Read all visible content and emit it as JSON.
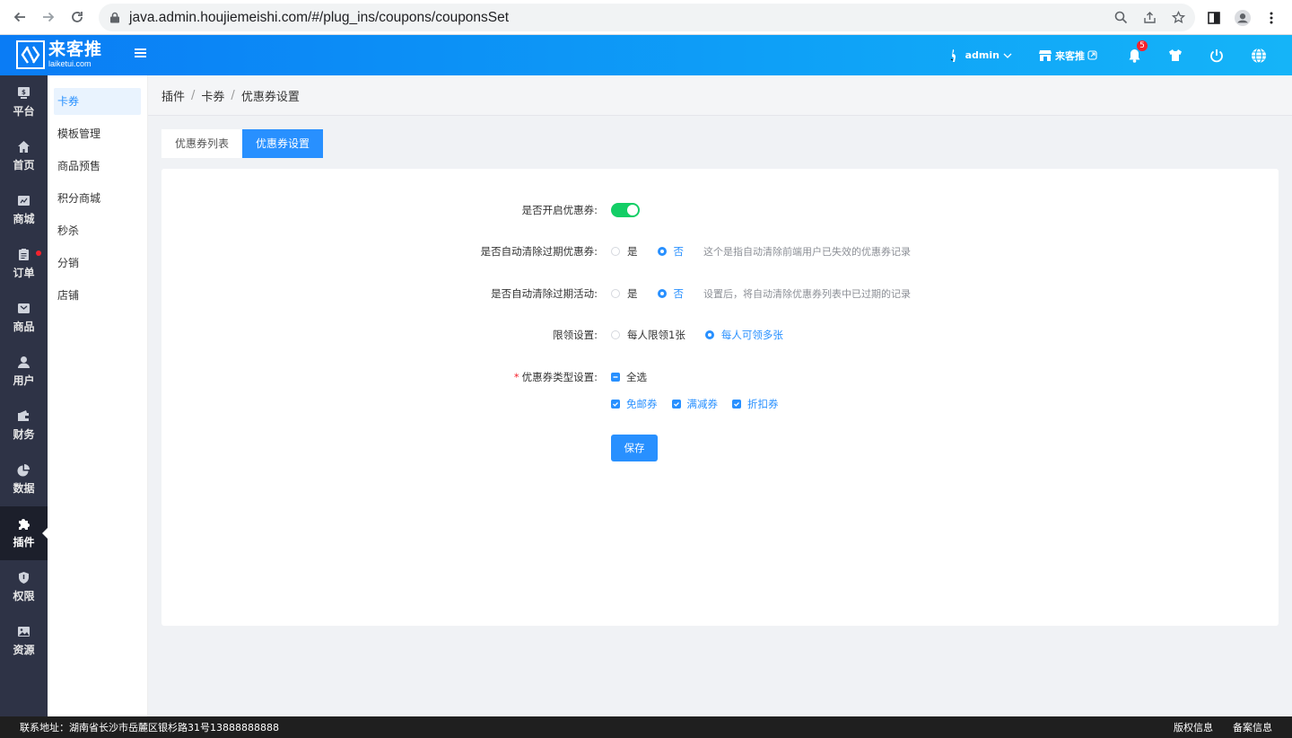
{
  "browser": {
    "url": "java.admin.houjiemeishi.com/#/plug_ins/coupons/couponsSet"
  },
  "header": {
    "logo_cn": "来客推",
    "logo_en": "laiketui.com",
    "user": "admin",
    "store": "来客推",
    "notification_count": "5"
  },
  "iconbar": {
    "items": [
      {
        "label": "平台",
        "icon": "platform-icon"
      },
      {
        "label": "首页",
        "icon": "home-icon"
      },
      {
        "label": "商城",
        "icon": "mall-icon"
      },
      {
        "label": "订单",
        "icon": "order-icon"
      },
      {
        "label": "商品",
        "icon": "goods-icon"
      },
      {
        "label": "用户",
        "icon": "user-icon"
      },
      {
        "label": "财务",
        "icon": "wallet-icon"
      },
      {
        "label": "数据",
        "icon": "pie-chart-icon"
      },
      {
        "label": "插件",
        "icon": "puzzle-icon"
      },
      {
        "label": "权限",
        "icon": "shield-icon"
      },
      {
        "label": "资源",
        "icon": "image-icon"
      }
    ],
    "active": "插件"
  },
  "subnav": {
    "items": [
      "卡券",
      "模板管理",
      "商品预售",
      "积分商城",
      "秒杀",
      "分销",
      "店铺"
    ],
    "active": "卡券"
  },
  "breadcrumb": [
    "插件",
    "卡券",
    "优惠券设置"
  ],
  "tabs": [
    "优惠券列表",
    "优惠券设置"
  ],
  "active_tab": "优惠券设置",
  "form": {
    "enable_label": "是否开启优惠券:",
    "enable_value": "on",
    "auto_clear_label": "是否自动清除过期优惠券:",
    "auto_clear_yes": "是",
    "auto_clear_no": "否",
    "auto_clear_selected": "否",
    "auto_clear_hint": "这个是指自动清除前端用户已失效的优惠券记录",
    "auto_clear_activity_label": "是否自动清除过期活动:",
    "auto_clear_activity_yes": "是",
    "auto_clear_activity_no": "否",
    "auto_clear_activity_selected": "否",
    "auto_clear_activity_hint": "设置后，将自动清除优惠券列表中已过期的记录",
    "limit_label": "限领设置:",
    "limit_one": "每人限领1张",
    "limit_many": "每人可领多张",
    "limit_selected": "每人可领多张",
    "type_label": "优惠券类型设置:",
    "select_all": "全选",
    "types": [
      "免邮券",
      "满减券",
      "折扣券"
    ],
    "save": "保存"
  },
  "footer": {
    "address": "联系地址：湖南省长沙市岳麓区银杉路31号13888888888",
    "copyright": "版权信息",
    "record": "备案信息"
  },
  "colors": {
    "primary": "#2890ff",
    "switch_on": "#13ce66",
    "sidebar_bg": "#2e3346",
    "header_gradient_start": "#0a7cf5",
    "header_gradient_end": "#15b4f8"
  }
}
